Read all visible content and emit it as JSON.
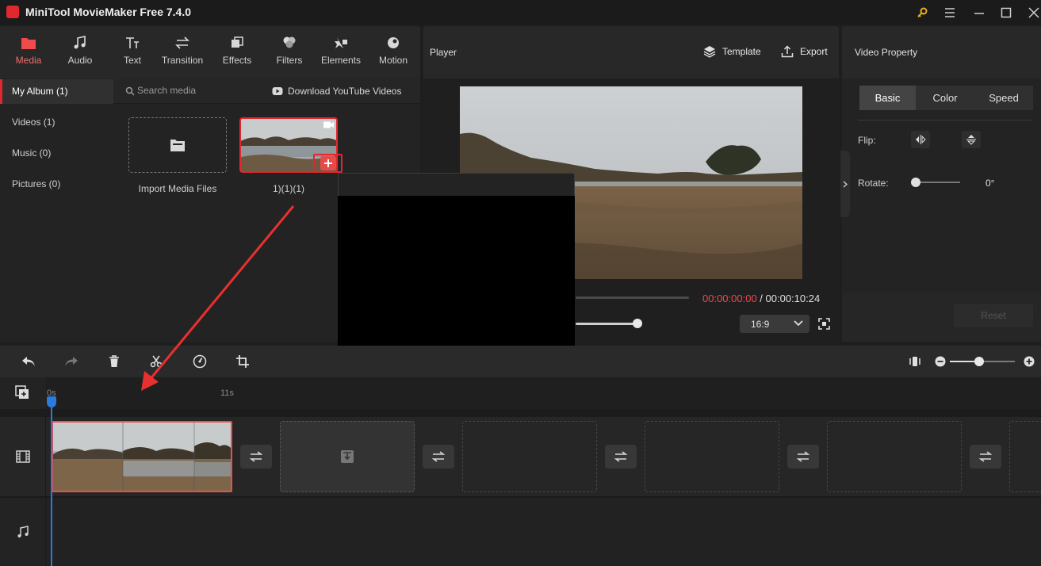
{
  "titlebar": {
    "title": "MiniTool MovieMaker Free 7.4.0"
  },
  "toolbar": {
    "tabs": [
      {
        "label": "Media",
        "icon": "folder-icon"
      },
      {
        "label": "Audio",
        "icon": "music-note-icon"
      },
      {
        "label": "Text",
        "icon": "text-icon"
      },
      {
        "label": "Transition",
        "icon": "transition-arrows-icon"
      },
      {
        "label": "Effects",
        "icon": "effects-icon"
      },
      {
        "label": "Filters",
        "icon": "filters-icon"
      },
      {
        "label": "Elements",
        "icon": "elements-icon"
      },
      {
        "label": "Motion",
        "icon": "motion-icon"
      }
    ]
  },
  "album": {
    "items": [
      {
        "label": "My Album (1)"
      },
      {
        "label": "Videos (1)"
      },
      {
        "label": "Music (0)"
      },
      {
        "label": "Pictures (0)"
      }
    ]
  },
  "media": {
    "search_placeholder": "Search media",
    "download_label": "Download YouTube Videos",
    "import_label": "Import Media Files",
    "clip_name": "1)(1)(1)"
  },
  "player": {
    "title": "Player",
    "template_label": "Template",
    "export_label": "Export",
    "current_time": "00:00:00:00",
    "separator": " / ",
    "total_time": "00:00:10:24",
    "aspect": "16:9"
  },
  "property": {
    "title": "Video Property",
    "tabs": [
      {
        "label": "Basic"
      },
      {
        "label": "Color"
      },
      {
        "label": "Speed"
      }
    ],
    "flip_label": "Flip:",
    "rotate_label": "Rotate:",
    "rotate_value": "0°",
    "reset_label": "Reset"
  },
  "timeline": {
    "ruler": [
      {
        "label": "0s"
      },
      {
        "label": "11s"
      }
    ]
  },
  "colors": {
    "accent": "#e0282e",
    "playhead": "#2a7bdc",
    "timecode_current": "#f04a4a"
  }
}
